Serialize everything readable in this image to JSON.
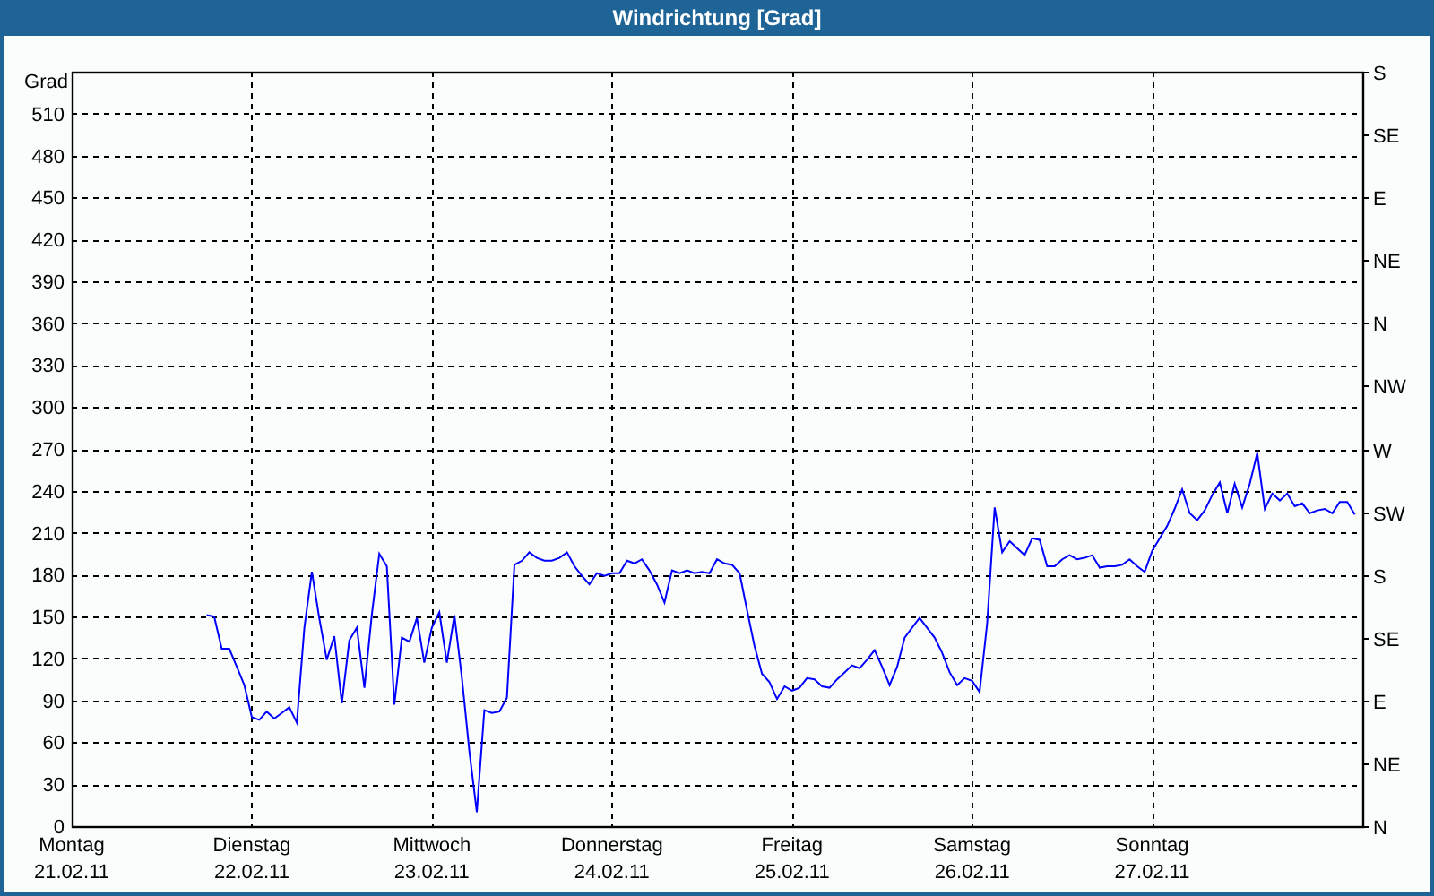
{
  "window": {
    "title": "Windrichtung [Grad]"
  },
  "chart": {
    "right_axis_labels": [
      "S",
      "SE",
      "E",
      "NE",
      "N",
      "NW",
      "W",
      "SW",
      "S",
      "SE",
      "E",
      "NE",
      "N"
    ],
    "x_axis_dates": [
      "21.02.11",
      "22.02.11",
      "23.02.11",
      "24.02.11",
      "25.02.11",
      "26.02.11",
      "27.02.11"
    ],
    "chart_data": {
      "type": "line",
      "ylabel": "Grad",
      "grid": true,
      "ylim": [
        0,
        540
      ],
      "yticks": [
        0,
        30,
        60,
        90,
        120,
        150,
        180,
        210,
        240,
        270,
        300,
        330,
        360,
        390,
        420,
        450,
        480,
        510
      ],
      "categories": [
        "Montag",
        null,
        null,
        null,
        null,
        null,
        null,
        null,
        null,
        null,
        null,
        null,
        null,
        null,
        null,
        null,
        null,
        null,
        null,
        null,
        null,
        null,
        null,
        null,
        "Dienstag",
        null,
        null,
        null,
        null,
        null,
        null,
        null,
        null,
        null,
        null,
        null,
        null,
        null,
        null,
        null,
        null,
        null,
        null,
        null,
        null,
        null,
        null,
        null,
        "Mittwoch",
        null,
        null,
        null,
        null,
        null,
        null,
        null,
        null,
        null,
        null,
        null,
        null,
        null,
        null,
        null,
        null,
        null,
        null,
        null,
        null,
        null,
        null,
        null,
        "Donnerstag",
        null,
        null,
        null,
        null,
        null,
        null,
        null,
        null,
        null,
        null,
        null,
        null,
        null,
        null,
        null,
        null,
        null,
        null,
        null,
        null,
        null,
        null,
        null,
        "Freitag",
        null,
        null,
        null,
        null,
        null,
        null,
        null,
        null,
        null,
        null,
        null,
        null,
        null,
        null,
        null,
        null,
        null,
        null,
        null,
        null,
        null,
        null,
        null,
        "Samstag",
        null,
        null,
        null,
        null,
        null,
        null,
        null,
        null,
        null,
        null,
        null,
        null,
        null,
        null,
        null,
        null,
        null,
        null,
        null,
        null,
        null,
        null,
        null,
        "Sonntag",
        null,
        null,
        null,
        null,
        null,
        null,
        null,
        null,
        null,
        null,
        null,
        null,
        null,
        null,
        null,
        null,
        null,
        null,
        null,
        null,
        null,
        null,
        null,
        null,
        null,
        null,
        null
      ],
      "series": [
        {
          "color": "#0000ff",
          "values": [
            null,
            null,
            null,
            null,
            null,
            null,
            null,
            null,
            null,
            null,
            null,
            null,
            null,
            null,
            null,
            null,
            null,
            null,
            151,
            150,
            127,
            127,
            114,
            101,
            78,
            76,
            82,
            77,
            81,
            85,
            74,
            142,
            182,
            149,
            119,
            136,
            88,
            133,
            142,
            99,
            151,
            195,
            186,
            87,
            135,
            132,
            149,
            117,
            142,
            153,
            117,
            151,
            106,
            53,
            10,
            83,
            81,
            82,
            92,
            187,
            190,
            196,
            192,
            190,
            190,
            192,
            196,
            186,
            179,
            173,
            181,
            179,
            181,
            181,
            190,
            188,
            191,
            183,
            173,
            160,
            183,
            181,
            183,
            181,
            182,
            181,
            191,
            188,
            187,
            181,
            155,
            129,
            109,
            103,
            91,
            100,
            97,
            99,
            106,
            105,
            100,
            99,
            105,
            110,
            115,
            113,
            119,
            126,
            114,
            101,
            114,
            135,
            142,
            149,
            142,
            135,
            124,
            110,
            101,
            106,
            104,
            96,
            145,
            228,
            196,
            204,
            199,
            194,
            206,
            205,
            186,
            186,
            191,
            194,
            191,
            192,
            194,
            185,
            186,
            186,
            187,
            191,
            186,
            182,
            197,
            206,
            215,
            227,
            241,
            224,
            219,
            226,
            237,
            246,
            224,
            245,
            228,
            245,
            267,
            227,
            238,
            233,
            238,
            229,
            231,
            224,
            226,
            227,
            224,
            232,
            232,
            223
          ]
        }
      ]
    }
  }
}
